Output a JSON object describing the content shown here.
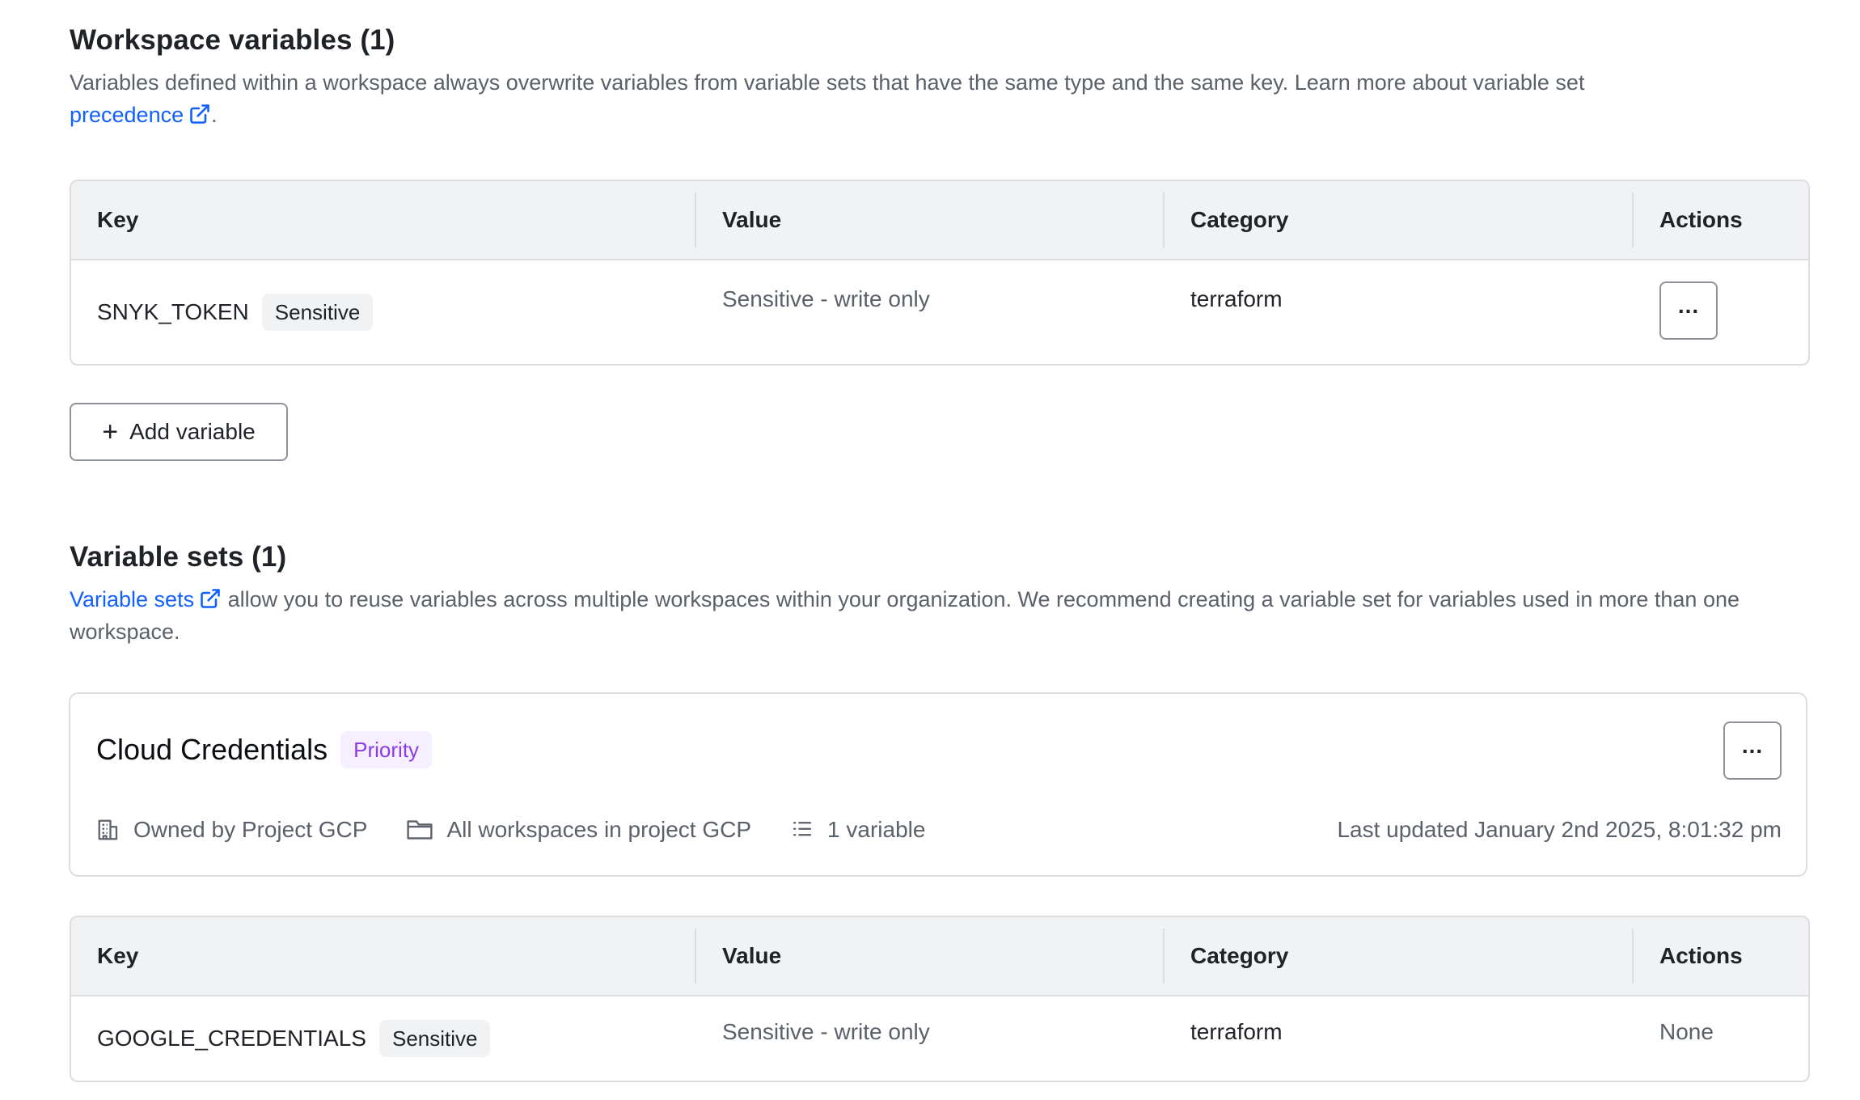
{
  "workspace": {
    "title": "Workspace variables (1)",
    "desc_text": "Variables defined within a workspace always overwrite variables from variable sets that have the same type and the same key. Learn more about variable set ",
    "desc_link": "precedence",
    "desc_end": ".",
    "columns": [
      "Key",
      "Value",
      "Category",
      "Actions"
    ],
    "rows": [
      {
        "key": "SNYK_TOKEN",
        "badge": "Sensitive",
        "value": "Sensitive - write only",
        "category": "terraform",
        "actions": "..."
      }
    ],
    "add_button": "Add variable"
  },
  "varsets": {
    "title": "Variable sets (1)",
    "desc_link": "Variable sets",
    "desc_text": " allow you to reuse variables across multiple workspaces within your organization. We recommend creating a variable set for variables used in more than one workspace.",
    "card": {
      "name": "Cloud Credentials",
      "badge": "Priority",
      "owned_by": "Owned by Project GCP",
      "scope": "All workspaces in project GCP",
      "count": "1 variable",
      "updated": "Last updated January 2nd 2025, 8:01:32 pm"
    },
    "columns": [
      "Key",
      "Value",
      "Category",
      "Actions"
    ],
    "rows": [
      {
        "key": "GOOGLE_CREDENTIALS",
        "badge": "Sensitive",
        "value": "Sensitive - write only",
        "category": "terraform",
        "actions": "None"
      }
    ]
  },
  "colors": {
    "link": "#1060ff",
    "priority": "#8a3de5",
    "muted": "#5b616a"
  },
  "icons": [
    "external-link-icon",
    "plus-icon",
    "more-icon",
    "building-icon",
    "folder-icon",
    "list-icon"
  ]
}
